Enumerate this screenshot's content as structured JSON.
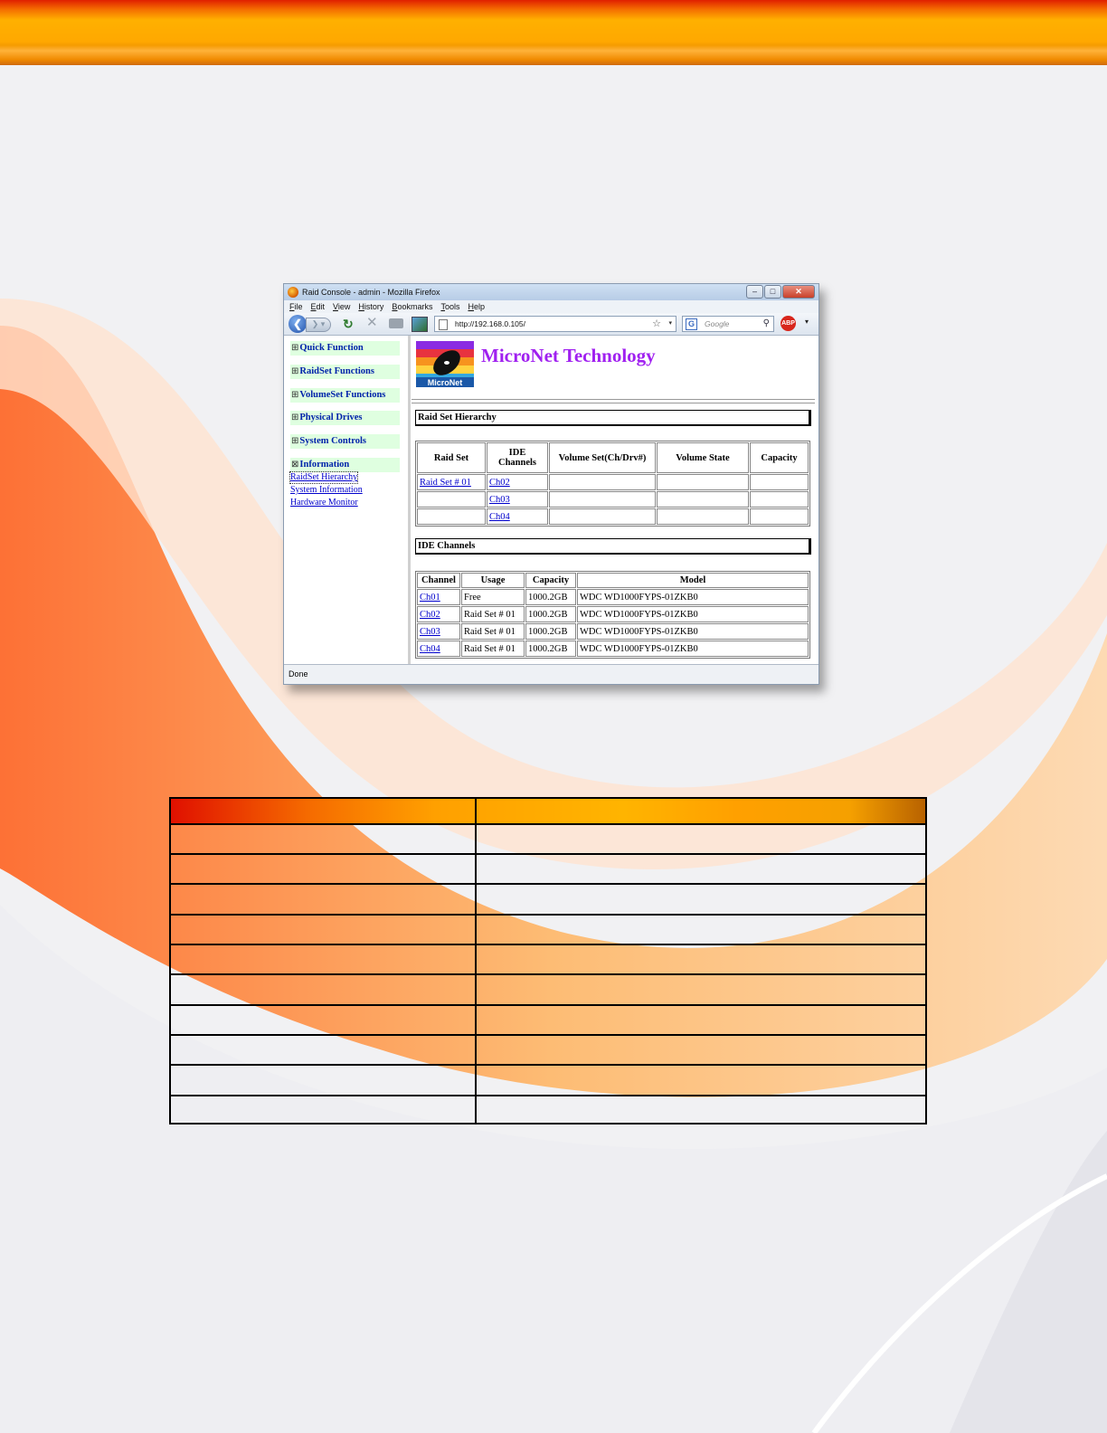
{
  "browser": {
    "window_title": "Raid Console - admin - Mozilla Firefox",
    "menu": [
      "File",
      "Edit",
      "View",
      "History",
      "Bookmarks",
      "Tools",
      "Help"
    ],
    "url": "http://192.168.0.105/",
    "search_placeholder": "Google",
    "search_engine_icon": "G",
    "abp_label": "ABP",
    "status": "Done"
  },
  "sidebar": {
    "items": [
      {
        "symbol": "⊞",
        "label": "Quick Function"
      },
      {
        "symbol": "⊞",
        "label": "RaidSet Functions"
      },
      {
        "symbol": "⊞",
        "label": "VolumeSet Functions"
      },
      {
        "symbol": "⊞",
        "label": "Physical Drives"
      },
      {
        "symbol": "⊞",
        "label": "System Controls"
      },
      {
        "symbol": "⊠",
        "label": "Information"
      }
    ],
    "links": [
      "RaidSet Hierarchy",
      "System Information",
      "Hardware Monitor"
    ]
  },
  "header": {
    "brand": "MicroNet Technology",
    "logo_text": "MicroNet"
  },
  "raidset_hierarchy": {
    "title": "Raid Set Hierarchy",
    "columns": [
      "Raid Set",
      "IDE Channels",
      "Volume Set(Ch/Drv#)",
      "Volume State",
      "Capacity"
    ],
    "rows": [
      [
        "Raid Set # 01",
        "Ch02",
        "",
        "",
        ""
      ],
      [
        "",
        "Ch03",
        "",
        "",
        ""
      ],
      [
        "",
        "Ch04",
        "",
        "",
        ""
      ]
    ]
  },
  "ide_channels": {
    "title": "IDE Channels",
    "columns": [
      "Channel",
      "Usage",
      "Capacity",
      "Model"
    ],
    "rows": [
      [
        "Ch01",
        "Free",
        "1000.2GB",
        "WDC WD1000FYPS-01ZKB0"
      ],
      [
        "Ch02",
        "Raid Set # 01",
        "1000.2GB",
        "WDC WD1000FYPS-01ZKB0"
      ],
      [
        "Ch03",
        "Raid Set # 01",
        "1000.2GB",
        "WDC WD1000FYPS-01ZKB0"
      ],
      [
        "Ch04",
        "Raid Set # 01",
        "1000.2GB",
        "WDC WD1000FYPS-01ZKB0"
      ]
    ]
  },
  "colors": {
    "brand": "#a020f0",
    "link": "#0000cc",
    "sidebar_item_bg": "#dfffe0",
    "accent_orange": "#ffa800"
  }
}
